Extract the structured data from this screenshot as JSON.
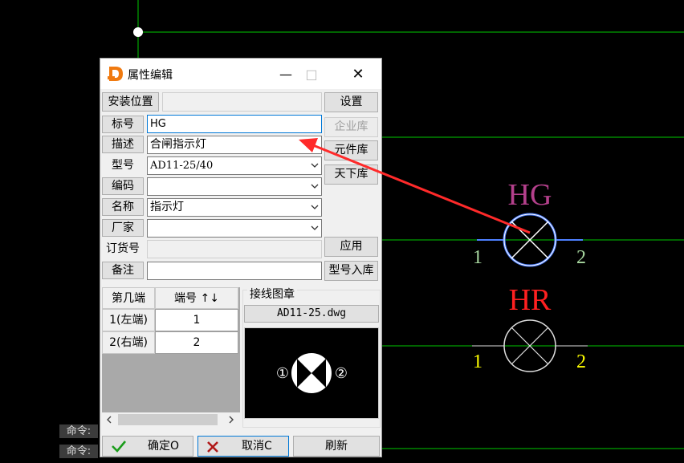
{
  "canvas": {
    "symbol_hg": {
      "label": "HG",
      "pin_left": "1",
      "pin_right": "2",
      "label_color": "#b4408c",
      "pin_color": "#a8d8a0",
      "circle_color": "#4d7fff"
    },
    "symbol_hr": {
      "label": "HR",
      "pin_left": "1",
      "pin_right": "2",
      "label_color": "#ff2020",
      "pin_color": "#ffff00",
      "circle_color": "#e0e0e0"
    },
    "line_color": "#00c800",
    "arrow_color": "#ff2a2a"
  },
  "command_line": {
    "prompt1": "命令:",
    "prompt2": "命令:"
  },
  "dialog": {
    "title": "属性编辑",
    "title_buttons": {
      "minimize": "—",
      "maximize": "□",
      "close": "✕"
    },
    "fields": {
      "install_location": {
        "label": "安装位置",
        "value": ""
      },
      "tag": {
        "label": "标号",
        "value": "HG"
      },
      "description": {
        "label": "描述",
        "value": "合闸指示灯"
      },
      "model": {
        "label": "型号",
        "value": "AD11-25/40"
      },
      "code": {
        "label": "编码",
        "value": ""
      },
      "name": {
        "label": "名称",
        "value": "指示灯"
      },
      "manufacturer": {
        "label": "厂家",
        "value": ""
      },
      "order_no": {
        "label": "订货号",
        "value": ""
      },
      "remark": {
        "label": "备注",
        "value": ""
      }
    },
    "side_buttons": {
      "settings": "设置",
      "enterprise_lib": "企业库",
      "component_lib": "元件库",
      "world_lib": "天下库",
      "apply": "应用",
      "model_to_lib": "型号入库"
    },
    "terminal_table": {
      "headers": [
        "第几端",
        "端号 ↑↓"
      ],
      "rows": [
        {
          "position": "1(左端)",
          "number": "1"
        },
        {
          "position": "2(右端)",
          "number": "2"
        }
      ]
    },
    "wiring_group": {
      "title": "接线图章",
      "dwg_name": "AD11-25.dwg",
      "preview_pin_left": "①",
      "preview_pin_right": "②"
    },
    "bottom_buttons": {
      "ok": "确定O",
      "cancel": "取消C",
      "refresh": "刷新"
    }
  }
}
